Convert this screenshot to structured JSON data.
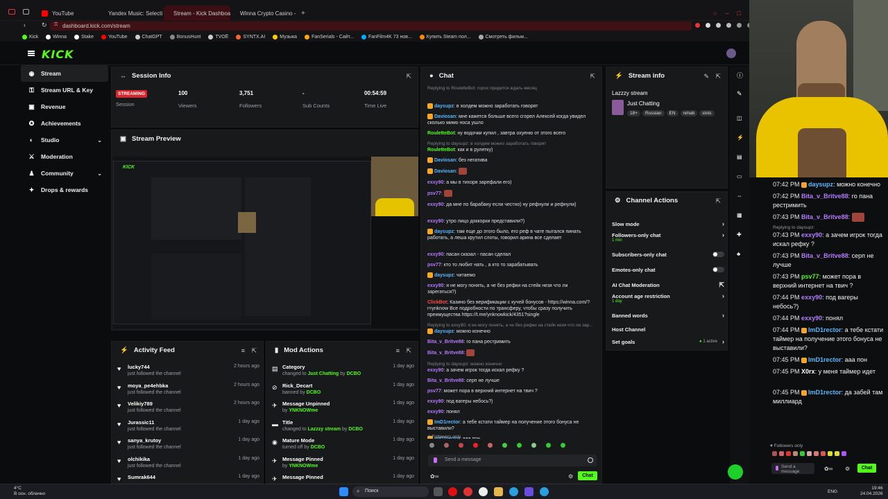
{
  "browser": {
    "tabs": [
      {
        "label": "YouTube",
        "color": "#ff0000",
        "active": false
      },
      {
        "label": "Yandex Music: Selecti",
        "color": "#ffcc00",
        "active": false
      },
      {
        "label": "Stream - Kick Dashboard",
        "color": "#53fc18",
        "active": true
      },
      {
        "label": "Winna Crypto Casino - Be",
        "color": "#888888",
        "active": false
      }
    ],
    "url": "dashboard.kick.com/stream",
    "bookmarks": [
      {
        "label": "Kick",
        "color": "#53fc18"
      },
      {
        "label": "Winna",
        "color": "#ffffff"
      },
      {
        "label": "Stake",
        "color": "#ffffff"
      },
      {
        "label": "YouTube",
        "color": "#ff0000"
      },
      {
        "label": "ChatGPT",
        "color": "#cccccc"
      },
      {
        "label": "BonusHunt",
        "color": "#888888"
      },
      {
        "label": "TVOË",
        "color": "#cccccc"
      },
      {
        "label": "SYNTX.AI",
        "color": "#ff6633"
      },
      {
        "label": "Музыка",
        "color": "#ffcc00"
      },
      {
        "label": "FanSerials - Сайт...",
        "color": "#ffaa00"
      },
      {
        "label": "FanFilm4K 73 нов...",
        "color": "#00aaff"
      },
      {
        "label": "Купить Steam пол...",
        "color": "#ff8800"
      },
      {
        "label": "Смотреть фильм...",
        "color": "#aaaaaa"
      }
    ]
  },
  "logo": "KICK",
  "sidebar": {
    "items": [
      {
        "label": "Stream",
        "icon": "broadcast-icon",
        "glyph": "◉",
        "chevron": false,
        "active": true
      },
      {
        "label": "Stream URL & Key",
        "icon": "key-icon",
        "glyph": "⚿",
        "chevron": false,
        "active": false
      },
      {
        "label": "Revenue",
        "icon": "revenue-icon",
        "glyph": "▣",
        "chevron": false,
        "active": false
      },
      {
        "label": "Achievements",
        "icon": "trophy-icon",
        "glyph": "✪",
        "chevron": false,
        "active": false
      },
      {
        "label": "Studio",
        "icon": "studio-icon",
        "glyph": "◐",
        "chevron": true,
        "active": false
      },
      {
        "label": "Moderation",
        "icon": "sword-icon",
        "glyph": "⚔",
        "chevron": false,
        "active": false
      },
      {
        "label": "Community",
        "icon": "community-icon",
        "glyph": "♟",
        "chevron": true,
        "active": false
      },
      {
        "label": "Drops & rewards",
        "icon": "gift-icon",
        "glyph": "✦",
        "chevron": false,
        "active": false
      }
    ]
  },
  "session": {
    "title": "Session Info",
    "badge": "STREAMING",
    "stats": [
      {
        "value": "",
        "label": "Session"
      },
      {
        "value": "100",
        "label": "Viewers"
      },
      {
        "value": "3,751",
        "label": "Followers"
      },
      {
        "value": "-",
        "label": "Sub Counts"
      },
      {
        "value": "00:54:59",
        "label": "Time Live"
      }
    ]
  },
  "preview": {
    "title": "Stream Preview"
  },
  "activity": {
    "title": "Activity Feed",
    "rows": [
      {
        "name": "lucky744",
        "sub": "just followed the channel",
        "time": "2 hours ago"
      },
      {
        "name": "moya_pe4ehbka",
        "sub": "just followed the channel",
        "time": "2 hours ago"
      },
      {
        "name": "Velikiy789",
        "sub": "just followed the channel",
        "time": "2 hours ago"
      },
      {
        "name": "Jurassic11",
        "sub": "just followed the channel",
        "time": "1 day ago"
      },
      {
        "name": "sanya_krutoy",
        "sub": "just followed the channel",
        "time": "1 day ago"
      },
      {
        "name": "olchikika",
        "sub": "just followed the channel",
        "time": "1 day ago"
      },
      {
        "name": "Sumrak644",
        "sub": "",
        "time": "1 day ago"
      }
    ]
  },
  "modactions": {
    "title": "Mod Actions",
    "rows": [
      {
        "name": "Category",
        "pre": "changed to ",
        "a": "Just Chatting",
        "mid": " by ",
        "b": "DCBO",
        "time": "1 day ago"
      },
      {
        "name": "Rick_Decart",
        "pre": "banned by ",
        "a": "",
        "mid": "",
        "b": "DCBO",
        "time": "1 day ago"
      },
      {
        "name": "Message Unpinned",
        "pre": "by ",
        "a": "",
        "mid": "",
        "b": "YNKNOWme",
        "time": "1 day ago"
      },
      {
        "name": "Title",
        "pre": "changed to ",
        "a": "Lazzzy stream",
        "mid": " by ",
        "b": "DCBO",
        "time": "1 day ago"
      },
      {
        "name": "Mature Mode",
        "pre": "turned off by ",
        "a": "",
        "mid": "",
        "b": "DCBO",
        "time": "1 day ago"
      },
      {
        "name": "Message Pinned",
        "pre": "by ",
        "a": "",
        "mid": "",
        "b": "YNKNOWme",
        "time": "1 day ago"
      },
      {
        "name": "Message Pinned",
        "pre": "",
        "a": "",
        "mid": "",
        "b": "",
        "time": "1 day ago"
      }
    ]
  },
  "chat": {
    "title": "Chat",
    "lines": [
      {
        "reply": "Replying to RouletteBot: гороx придется ждать месяц",
        "user": "",
        "color": "",
        "text": ""
      },
      {
        "reply": "",
        "user": "daysupz",
        "color": "#58b7ff",
        "text": "в холдем можно заработать говорят"
      },
      {
        "reply": "",
        "user": "Daviosan",
        "color": "#58b7ff",
        "text": "мне кажется больше всего сгорел Алексей когда увидел сколько мимо носа ушло"
      },
      {
        "reply": "",
        "user": "RouletteBot",
        "color": "#53fc18",
        "text": "ну водочки купил , завтра охуеню от этого всего"
      },
      {
        "reply": "Replying to daysupz: в холдем можно заработать говорят",
        "user": "RouletteBot",
        "color": "#53fc18",
        "text": "как и в рулетку)"
      },
      {
        "reply": "",
        "user": "Daviosan",
        "color": "#58b7ff",
        "text": "без негатива"
      },
      {
        "reply": "",
        "user": "Daviosan",
        "color": "#58b7ff",
        "text": ""
      },
      {
        "reply": "",
        "user": "exxy90",
        "color": "#b57bff",
        "text": "а мы в тихоря зарефали его)"
      },
      {
        "reply": "",
        "user": "psv77",
        "color": "#b57bff",
        "text": ""
      },
      {
        "reply": "",
        "user": "exxy90",
        "color": "#b57bff",
        "text": "да мне по барабану если честно) ну рефнули и рефнули)"
      },
      {
        "reply": "",
        "user": "exxy90",
        "color": "#b57bff",
        "text": "утро лицо доккорки представили?)"
      },
      {
        "reply": "",
        "user": "daysupz",
        "color": "#58b7ff",
        "text": "там еще до этого было, его реф в чате пытался пинать работать, а леша крутил слоты, говорил арина все сделает"
      },
      {
        "reply": "",
        "user": "exxy90",
        "color": "#b57bff",
        "text": "пасан сказал - пасан сделал"
      },
      {
        "reply": "",
        "user": "psv77",
        "color": "#b57bff",
        "text": "кто то любит нать , а кто то зарабатывать"
      },
      {
        "reply": "",
        "user": "daysupz",
        "color": "#58b7ff",
        "text": "читаемо"
      },
      {
        "reply": "",
        "user": "exxy90",
        "color": "#b57bff",
        "text": "я не могу понять, а че без рефки на стейк незя что ли зарегаться?)"
      },
      {
        "reply": "",
        "user": "ClickBot",
        "color": "#ff4d4d",
        "text": "Казино без верификации с кучей бонусов - https://winna.com/?r=ynknow Все подробности по трансферу, чтобы сразу получить преимущества https://t.me/ynknowkick/4351?single"
      },
      {
        "reply": "Replying to exxy90: я не могу понять, а че без рефки на стейк незя что ли зар...",
        "user": "daysupz",
        "color": "#58b7ff",
        "text": "можно конечно"
      },
      {
        "reply": "",
        "user": "Bita_v_Britve88",
        "color": "#b57bff",
        "text": "го пана рестримить"
      },
      {
        "reply": "",
        "user": "Bita_v_Britve88",
        "color": "#b57bff",
        "text": ""
      },
      {
        "reply": "Replying to daysupz: можно конечно",
        "user": "exxy90",
        "color": "#b57bff",
        "text": "а зачем игрок тогда искал рефку ?"
      },
      {
        "reply": "",
        "user": "Bita_v_Britve88",
        "color": "#b57bff",
        "text": "серп не лучше"
      },
      {
        "reply": "",
        "user": "psv77",
        "color": "#b57bff",
        "text": "может пора в верхний интернет на твич ?"
      },
      {
        "reply": "",
        "user": "exxy90",
        "color": "#b57bff",
        "text": "под вагеры небось?)"
      },
      {
        "reply": "",
        "user": "exxy90",
        "color": "#b57bff",
        "text": "понял"
      },
      {
        "reply": "",
        "user": "ImD1rector",
        "color": "#58b7ff",
        "text": "а тебе кстати таймер на получение этого бонуса не выставили?"
      },
      {
        "reply": "",
        "user": "ImD1rector",
        "color": "#58b7ff",
        "text": "ааа пон"
      },
      {
        "reply": "",
        "user": "X0rx",
        "color": "#ffffff",
        "text": "у меня таймер идет"
      },
      {
        "reply": "",
        "user": "ImD1rector",
        "color": "#58b7ff",
        "text": "да забей там миллиард"
      }
    ],
    "followers_only": "Followers only",
    "placeholder": "Send a message",
    "send_label": "Chat"
  },
  "streaminfo": {
    "title": "Stream info",
    "stream_title": "Lazzzy stream",
    "category": "Just Chatting",
    "tags": [
      "18+",
      "Russian",
      "EN",
      "rehab",
      "slots"
    ]
  },
  "channelactions": {
    "title": "Channel Actions",
    "items": [
      {
        "label": "Slow mode",
        "sub": "",
        "control": "chevron"
      },
      {
        "label": "Followers-only chat",
        "sub": "1 min",
        "control": "chevron"
      },
      {
        "label": "Subscribers-only chat",
        "sub": "",
        "control": "toggle"
      },
      {
        "label": "Emotes-only chat",
        "sub": "",
        "control": "toggle"
      },
      {
        "label": "AI Chat Moderation",
        "sub": "",
        "control": "external"
      },
      {
        "label": "Account age restriction",
        "sub": "1 day",
        "control": "chevron"
      },
      {
        "label": "Banned words",
        "sub": "",
        "control": "chevron"
      },
      {
        "label": "Host Channel",
        "sub": "",
        "control": "none"
      },
      {
        "label": "Set goals",
        "sub": "",
        "control": "goals",
        "status": "1 active"
      }
    ]
  },
  "sidechat": {
    "lines": [
      {
        "time": "07:42 PM",
        "user": "daysupz",
        "color": "#58b7ff",
        "text": "можно конечно"
      },
      {
        "time": "07:42 PM",
        "user": "Bita_v_Britve88",
        "color": "#b57bff",
        "text": "го пана рестримить"
      },
      {
        "time": "07:43 PM",
        "user": "Bita_v_Britve88",
        "color": "#b57bff",
        "text": ""
      },
      {
        "time": "07:43 PM",
        "user": "exxy90",
        "color": "#b57bff",
        "text": "а зачем игрок тогда искал рефку ?",
        "reply": "Replying to daysupz:"
      },
      {
        "time": "07:43 PM",
        "user": "Bita_v_Britve88",
        "color": "#b57bff",
        "text": "серп не лучше"
      },
      {
        "time": "07:43 PM",
        "user": "psv77",
        "color": "#53fc18",
        "text": "может пора в верхний интернет на твич ?"
      },
      {
        "time": "07:44 PM",
        "user": "exxy90",
        "color": "#b57bff",
        "text": "под вагеры небось?)"
      },
      {
        "time": "07:44 PM",
        "user": "exxy90",
        "color": "#b57bff",
        "text": "понял"
      },
      {
        "time": "07:44 PM",
        "user": "ImD1rector",
        "color": "#58b7ff",
        "text": "а тебе кстати таймер на получение этого бонуса не выставили?"
      },
      {
        "time": "07:45 PM",
        "user": "ImD1rector",
        "color": "#58b7ff",
        "text": "ааа пон"
      },
      {
        "time": "07:45 PM",
        "user": "X0rx",
        "color": "#ffffff",
        "text": "у меня таймер идет"
      },
      {
        "time": "07:45 PM",
        "user": "ImD1rector",
        "color": "#58b7ff",
        "text": "да забей там миллиард"
      }
    ],
    "followers_only": "Followers only",
    "placeholder": "Send a message",
    "send_label": "Chat"
  },
  "taskbar": {
    "weather": "4°C",
    "weather_sub": "В осн. облачно",
    "search": "Поиск",
    "lang": "ENG",
    "time": "19:46",
    "date": "24.04.2026"
  }
}
